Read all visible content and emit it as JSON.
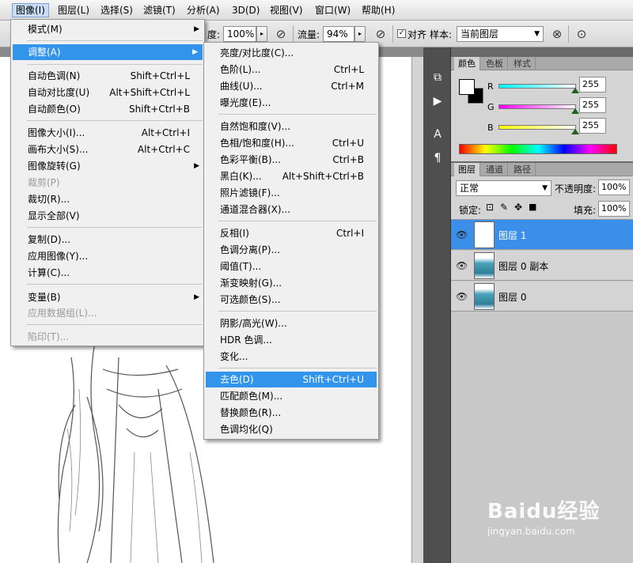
{
  "menubar": {
    "items": [
      "图像(I)",
      "图层(L)",
      "选择(S)",
      "滤镜(T)",
      "分析(A)",
      "3D(D)",
      "视图(V)",
      "窗口(W)",
      "帮助(H)"
    ]
  },
  "options": {
    "opacity_label_partial": "度:",
    "opacity_value": "100%",
    "flow_label": "流量:",
    "flow_value": "94%",
    "align_label": "对齐",
    "sample_label": "样本:",
    "sample_value": "当前图层"
  },
  "image_menu": {
    "items": [
      {
        "label": "模式(M)",
        "submenu": true
      },
      {
        "label": "调整(A)",
        "submenu": true,
        "highlighted": true
      },
      {
        "label": "自动色调(N)",
        "shortcut": "Shift+Ctrl+L"
      },
      {
        "label": "自动对比度(U)",
        "shortcut": "Alt+Shift+Ctrl+L"
      },
      {
        "label": "自动颜色(O)",
        "shortcut": "Shift+Ctrl+B"
      },
      {
        "label": "图像大小(I)...",
        "shortcut": "Alt+Ctrl+I"
      },
      {
        "label": "画布大小(S)...",
        "shortcut": "Alt+Ctrl+C"
      },
      {
        "label": "图像旋转(G)",
        "submenu": true
      },
      {
        "label": "裁剪(P)",
        "disabled": true
      },
      {
        "label": "裁切(R)..."
      },
      {
        "label": "显示全部(V)"
      },
      {
        "label": "复制(D)..."
      },
      {
        "label": "应用图像(Y)..."
      },
      {
        "label": "计算(C)..."
      },
      {
        "label": "变量(B)",
        "submenu": true
      },
      {
        "label": "应用数据组(L)...",
        "disabled": true
      },
      {
        "label": "陷印(T)...",
        "disabled": true
      }
    ]
  },
  "adjust_menu": {
    "items": [
      {
        "label": "亮度/对比度(C)..."
      },
      {
        "label": "色阶(L)...",
        "shortcut": "Ctrl+L"
      },
      {
        "label": "曲线(U)...",
        "shortcut": "Ctrl+M"
      },
      {
        "label": "曝光度(E)..."
      },
      {
        "label": "自然饱和度(V)..."
      },
      {
        "label": "色相/饱和度(H)...",
        "shortcut": "Ctrl+U"
      },
      {
        "label": "色彩平衡(B)...",
        "shortcut": "Ctrl+B"
      },
      {
        "label": "黑白(K)...",
        "shortcut": "Alt+Shift+Ctrl+B"
      },
      {
        "label": "照片滤镜(F)..."
      },
      {
        "label": "通道混合器(X)..."
      },
      {
        "label": "反相(I)",
        "shortcut": "Ctrl+I"
      },
      {
        "label": "色调分离(P)..."
      },
      {
        "label": "阈值(T)..."
      },
      {
        "label": "渐变映射(G)..."
      },
      {
        "label": "可选颜色(S)..."
      },
      {
        "label": "阴影/高光(W)..."
      },
      {
        "label": "HDR 色调..."
      },
      {
        "label": "变化..."
      },
      {
        "label": "去色(D)",
        "shortcut": "Shift+Ctrl+U",
        "highlighted": true
      },
      {
        "label": "匹配颜色(M)..."
      },
      {
        "label": "替换颜色(R)..."
      },
      {
        "label": "色调均化(Q)"
      }
    ]
  },
  "color_panel": {
    "tabs": [
      "颜色",
      "色板",
      "样式"
    ],
    "r_label": "R",
    "r_value": "255",
    "g_label": "G",
    "g_value": "255",
    "b_label": "B",
    "b_value": "255"
  },
  "layers_panel": {
    "tabs": [
      "图层",
      "通道",
      "路径"
    ],
    "blend_mode": "正常",
    "opacity_label": "不透明度:",
    "opacity_value": "100%",
    "lock_label": "锁定:",
    "fill_label": "填充:",
    "fill_value": "100%",
    "layers": [
      {
        "name": "图层 1",
        "selected": true
      },
      {
        "name": "图层 0 副本"
      },
      {
        "name": "图层 0"
      }
    ]
  },
  "watermark": {
    "brand": "Baidu经验",
    "url": "jingyan.baidu.com"
  }
}
